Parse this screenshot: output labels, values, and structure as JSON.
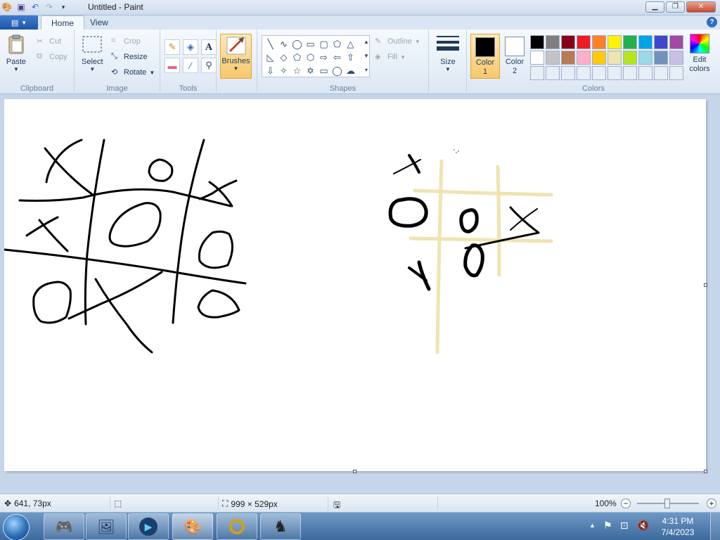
{
  "window": {
    "title": "Untitled - Paint"
  },
  "tabs": [
    {
      "label": "Home",
      "active": true
    },
    {
      "label": "View",
      "active": false
    }
  ],
  "ribbon": {
    "clipboard": {
      "label": "Clipboard",
      "paste": "Paste",
      "cut": "Cut",
      "copy": "Copy"
    },
    "image": {
      "label": "Image",
      "select": "Select",
      "crop": "Crop",
      "resize": "Resize",
      "rotate": "Rotate"
    },
    "tools": {
      "label": "Tools"
    },
    "brushes": {
      "label": "Brushes"
    },
    "shapes": {
      "label": "Shapes",
      "outline": "Outline",
      "fill": "Fill"
    },
    "size": {
      "label": "Size"
    },
    "colors": {
      "label": "Colors",
      "color1_label": "Color 1",
      "color2_label": "Color 2",
      "edit_label": "Edit colors",
      "color1": "#000000",
      "color2": "#ffffff",
      "palette_row1": [
        "#000000",
        "#7f7f7f",
        "#880015",
        "#ed1c24",
        "#ff7f27",
        "#fff200",
        "#22b14c",
        "#00a2e8",
        "#3f48cc",
        "#a349a4"
      ],
      "palette_row2": [
        "#ffffff",
        "#c3c3c3",
        "#b97a57",
        "#ffaec9",
        "#ffc90e",
        "#efe4b0",
        "#b5e61d",
        "#99d9ea",
        "#7092be",
        "#c8bfe7"
      ],
      "palette_row3": [
        "#e8eef6",
        "#e8eef6",
        "#e8eef6",
        "#e8eef6",
        "#e8eef6",
        "#e8eef6",
        "#e8eef6",
        "#e8eef6",
        "#e8eef6",
        "#e8eef6"
      ]
    }
  },
  "status": {
    "cursor_pos": "641, 73px",
    "selection_size": "",
    "canvas_size": "999 × 529px",
    "zoom": "100%"
  },
  "taskbar": {
    "time": "4:31 PM",
    "date": "7/4/2023"
  }
}
